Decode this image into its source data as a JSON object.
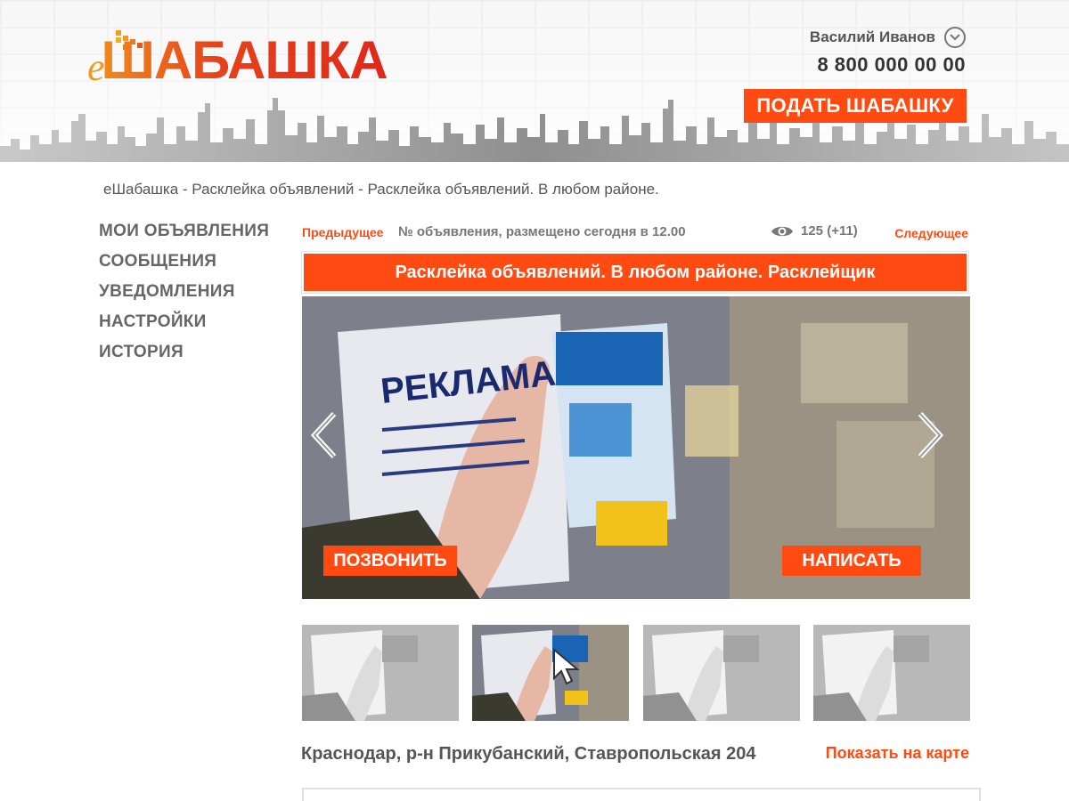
{
  "header": {
    "logo_prefix": "e",
    "logo_text": "ШАБАШКА",
    "user_name": "Василий Иванов",
    "phone": "8 800 000 00 00",
    "post_button": "ПОДАТЬ ШАБАШКУ"
  },
  "tagline": "еШабашка - Расклейка объявлений - Расклейка объявлений. В любом районе.",
  "sidebar": {
    "items": [
      {
        "label": "МОИ ОБЪЯВЛЕНИЯ"
      },
      {
        "label": "СООБЩЕНИЯ"
      },
      {
        "label": "УВЕДОМЛЕНИЯ"
      },
      {
        "label": "НАСТРОЙКИ"
      },
      {
        "label": "ИСТОРИЯ"
      }
    ]
  },
  "ad": {
    "prev_label": "Предыдущее",
    "info": "№ объявления, размещено сегодня в 12.00",
    "views": "125 (+11)",
    "next_label": "Следующее",
    "title": "Расклейка объявлений. В любом районе. Расклейщик",
    "call_button": "ПОЗВОНИТЬ",
    "write_button": "НАПИСАТЬ",
    "photo_poster_text": "РЕКЛАМА",
    "location": "Краснодар, р-н Прикубанский, Ставропольская 204",
    "map_link": "Показать на карте"
  },
  "colors": {
    "accent": "#ff4b12",
    "logo_orange": "#f29a1f",
    "logo_red": "#e0281a",
    "text": "#555555"
  },
  "icons": {
    "user_menu": "chevron-down-icon",
    "views": "eye-icon",
    "prev_photo": "chevron-left-icon",
    "next_photo": "chevron-right-icon",
    "cursor": "mouse-pointer-icon"
  },
  "thumbnails": [
    {
      "state": "inactive"
    },
    {
      "state": "active"
    },
    {
      "state": "inactive"
    },
    {
      "state": "inactive"
    }
  ]
}
